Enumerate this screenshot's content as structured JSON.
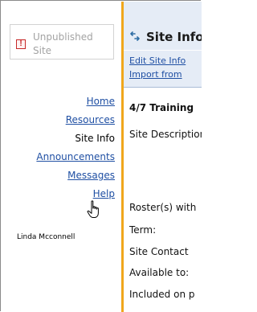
{
  "sidebar": {
    "unpublished_label": "Unpublished Site",
    "warning_glyph": "!",
    "nav": {
      "home": "Home",
      "resources": "Resources",
      "site_info": "Site Info",
      "announcements": "Announcements",
      "messages": "Messages",
      "help": "Help"
    },
    "user_name": "Linda Mcconnell"
  },
  "main": {
    "title": "Site Info",
    "actions": {
      "edit_site_info": "Edit Site Info",
      "import_from": "Import from"
    },
    "site_name": "4/7 Training",
    "fields": {
      "site_description": "Site Description",
      "roster": "Roster(s) with",
      "term": "Term:",
      "site_contact": "Site Contact",
      "available_to": "Available to:",
      "included_on": "Included on p"
    }
  },
  "colors": {
    "link": "#1f4fa3",
    "divider_accent": "#f0a71c",
    "header_bg": "#e5ecf6",
    "warning": "#c62828",
    "muted_text": "#a3a3a3"
  },
  "icons": {
    "unpublished": "warning-icon",
    "title": "wrench-icon",
    "cursor": "hand-pointer-cursor"
  }
}
